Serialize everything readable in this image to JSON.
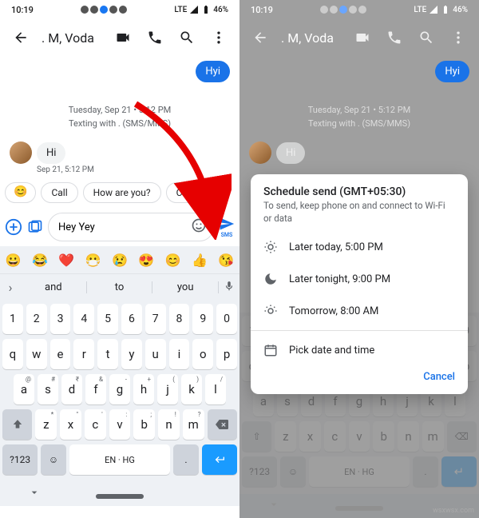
{
  "status": {
    "time": "10:19",
    "net": "LTE",
    "battery": "46%"
  },
  "header": {
    "title": ". M, Voda"
  },
  "chat": {
    "outgoing": "Hyi",
    "date_meta": "Tuesday, Sep 21 • 5:12 PM",
    "texting_meta": "Texting with . (SMS/MMS)",
    "incoming": "Hi",
    "incoming_ts": "Sep 21, 5:12 PM"
  },
  "suggestions": {
    "emoji": "😊",
    "s1": "Call",
    "s2": "How are you?",
    "s3": "Cool"
  },
  "compose": {
    "value": "Hey Yey",
    "send_label": "SMS"
  },
  "wordbar": {
    "w1": "and",
    "w2": "to",
    "w3": "you"
  },
  "kbd": {
    "nums": [
      "1",
      "2",
      "3",
      "4",
      "5",
      "6",
      "7",
      "8",
      "9",
      "0"
    ],
    "r1": [
      "q",
      "w",
      "e",
      "r",
      "t",
      "y",
      "u",
      "i",
      "o",
      "p"
    ],
    "r2": [
      "a",
      "s",
      "d",
      "f",
      "g",
      "h",
      "j",
      "k",
      "l"
    ],
    "r3": [
      "z",
      "x",
      "c",
      "v",
      "b",
      "n",
      "m"
    ],
    "sup2": [
      "@",
      "#",
      "₹",
      "&",
      "-",
      "+",
      "(",
      ")",
      "/"
    ],
    "sup3": [
      "*",
      "\"",
      "'",
      ":",
      ";",
      "!",
      "?"
    ],
    "symkey": "?123",
    "space": "EN · HG"
  },
  "dialog": {
    "title": "Schedule send (GMT+05:30)",
    "subtitle": "To send, keep phone on and connect to Wi-Fi or data",
    "opt1": "Later today, 5:00 PM",
    "opt2": "Later tonight, 9:00 PM",
    "opt3": "Tomorrow, 8:00 AM",
    "opt4": "Pick date and time",
    "cancel": "Cancel"
  },
  "watermark": "wsxwsx.com"
}
